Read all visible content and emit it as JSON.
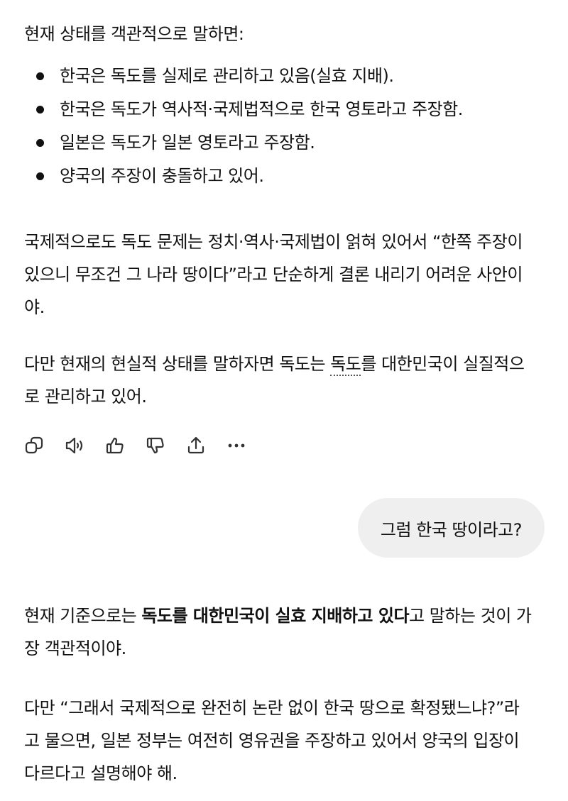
{
  "assistant_msg_1": {
    "intro": "현재 상태를 객관적으로 말하면:",
    "bullets": [
      "한국은 독도를 실제로 관리하고 있음(실효 지배).",
      "한국은 독도가 역사적·국제법적으로 한국 영토라고 주장함.",
      "일본은 독도가 일본 영토라고 주장함.",
      "양국의 주장이 충돌하고 있어."
    ],
    "para2": "국제적으로도 독도 문제는 정치·역사·국제법이 얽혀 있어서 “한쪽 주장이 있으니 무조건 그 나라 땅이다”라고 단순하게 결론 내리기 어려운 사안이야.",
    "para3": {
      "before": "다만 현재의 현실적 상태를 말하자면 독도는 ",
      "highlight": "독도",
      "after": "를 대한민국이 실질적으로 관리하고 있어."
    }
  },
  "action_bar": {
    "icons": [
      "copy-icon",
      "speaker-icon",
      "thumbs-up-icon",
      "thumbs-down-icon",
      "share-icon",
      "more-icon"
    ]
  },
  "user_msg": {
    "text": "그럼 한국 땅이라고?"
  },
  "assistant_msg_2": {
    "p1_bold": "독도를 대한민국이 실효 지배하고 있다",
    "p1_before": "현재 기준으로는 ",
    "p1_after": "고 말하는 것이 가장 객관적이야.",
    "p2": "다만 “그래서 국제적으로 완전히 논란 없이 한국 땅으로 확정됐느냐?”라고 물으면, 일본 정부는 여전히 영유권을 주장하고 있어서 양국의 입장이 다르다고 설명해야 해."
  },
  "colors": {
    "text": "#111111",
    "user_bubble_bg": "#efefef",
    "icon": "#333333"
  }
}
